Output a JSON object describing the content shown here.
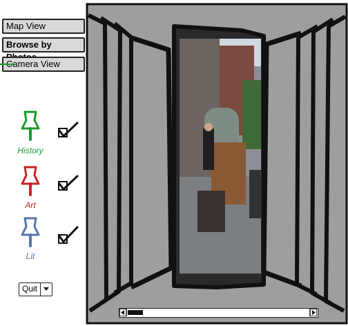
{
  "nav": {
    "map_view": "Map View",
    "browse_by_photos": "Browse by Photos",
    "camera_view": "Camera View"
  },
  "categories": [
    {
      "label": "History",
      "color": "#1a9a2a",
      "checked": true
    },
    {
      "label": "Art",
      "color": "#cc2222",
      "checked": true
    },
    {
      "label": "Lit",
      "color": "#5577aa",
      "checked": true
    }
  ],
  "quit": {
    "label": "Quit"
  },
  "viewer": {
    "background": "#9e9e9e"
  },
  "icons": {
    "pin": "pushpin-icon",
    "check": "checkbox-check-icon",
    "dropdown": "chevron-down-icon",
    "scroll_left": "arrow-left-icon",
    "scroll_right": "arrow-right-icon"
  }
}
